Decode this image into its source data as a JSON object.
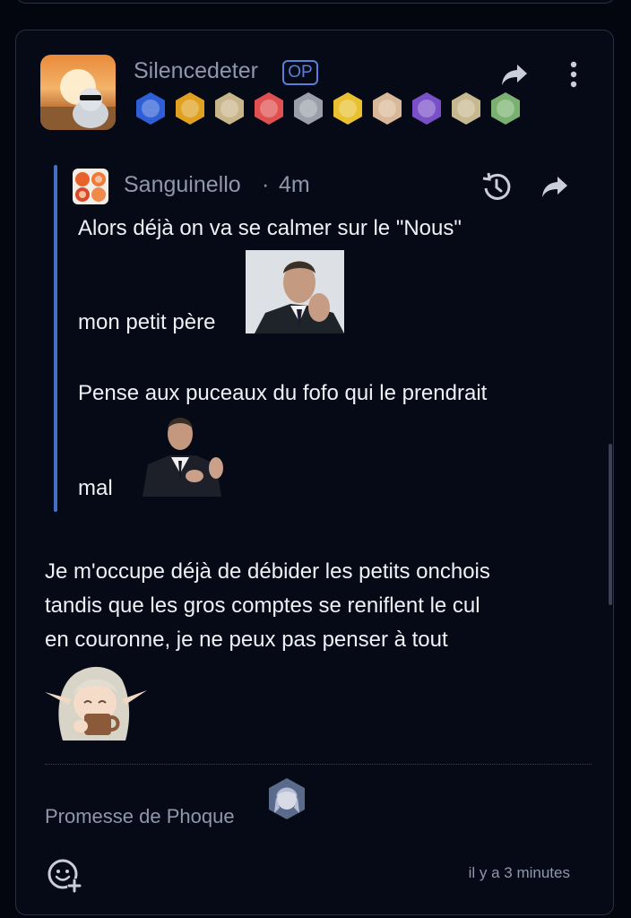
{
  "post": {
    "author": {
      "username": "Silencedeter",
      "op_label": "OP",
      "badges": [
        {
          "icon": "crown-badge-icon",
          "color": "#2f5fd6"
        },
        {
          "icon": "dollar-badge-icon",
          "color": "#e0a020"
        },
        {
          "icon": "portrait-badge-icon",
          "color": "#c9b58a"
        },
        {
          "icon": "clown-badge-icon",
          "color": "#e05050"
        },
        {
          "icon": "man-badge-icon",
          "color": "#9aa0aa"
        },
        {
          "icon": "emoji-badge-icon",
          "color": "#e8c030"
        },
        {
          "icon": "face-badge-icon",
          "color": "#d8b898"
        },
        {
          "icon": "moon-badge-icon",
          "color": "#7a50c8"
        },
        {
          "icon": "anime-badge-icon",
          "color": "#c8b890"
        },
        {
          "icon": "character-badge-icon",
          "color": "#7ab070"
        }
      ]
    },
    "quote": {
      "author": "Sanguinello",
      "separator": "·",
      "time": "4m",
      "lines": [
        "Alors déjà on va se calmer sur le \"Nous\"",
        "mon petit père",
        "Pense aux puceaux du fofo qui le prendrait",
        "mal"
      ]
    },
    "body_lines": [
      "Je m'occupe déjà de débider les petits onchois",
      "tandis que les gros comptes se reniflent le cul",
      "en couronne, je ne peux pas penser à tout"
    ],
    "signature": "Promesse de Phoque",
    "timestamp": "il y a 3 minutes"
  },
  "colors": {
    "background": "#03060f",
    "card": "#050a16",
    "accent": "#5b7fd6",
    "quote_bar": "#4470c4",
    "muted_text": "#8f97ad"
  }
}
